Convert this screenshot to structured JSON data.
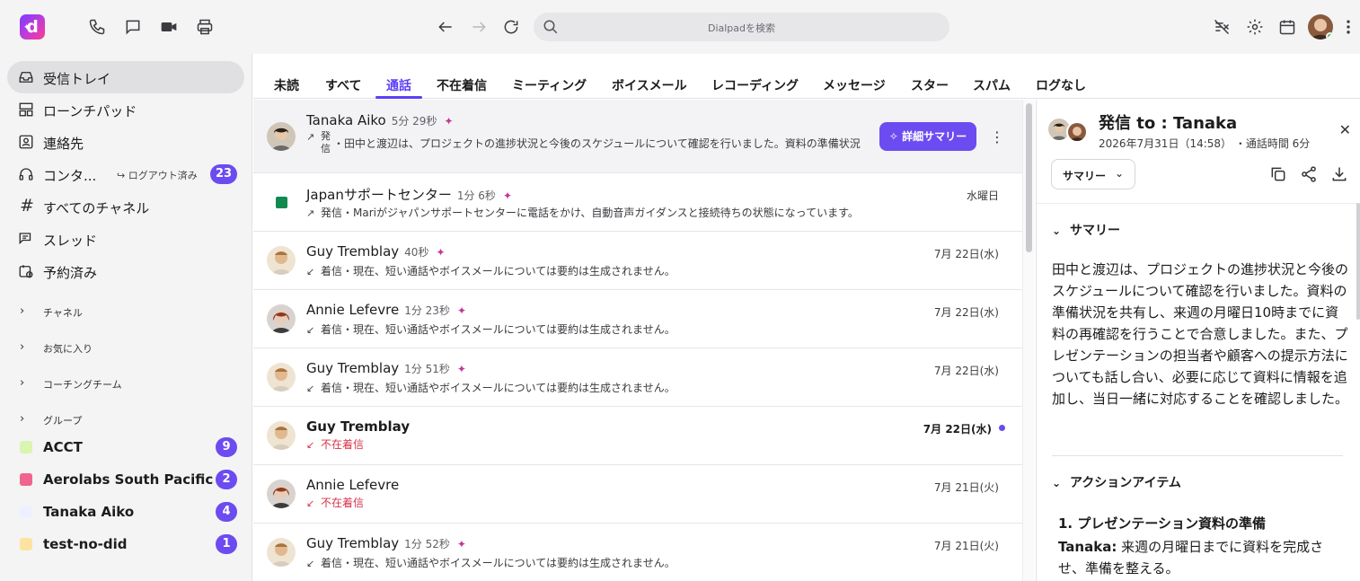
{
  "topbar": {
    "logo_letter": "d",
    "search_placeholder": "Dialpadを検索",
    "icons": [
      "phone-icon",
      "chat-icon",
      "video-icon",
      "print-icon",
      "back-arrow-icon",
      "forward-arrow-icon",
      "refresh-icon",
      "no-music-icon",
      "gear-icon",
      "calendar-icon",
      "more-vertical-icon"
    ]
  },
  "sidebar": {
    "nav": [
      {
        "label": "受信トレイ",
        "icon": "inbox-icon"
      },
      {
        "label": "ローンチパッド",
        "icon": "launchpad-icon"
      },
      {
        "label": "連絡先",
        "icon": "contacts-icon"
      },
      {
        "label": "コンタ...",
        "icon": "headset-icon",
        "sub": "ログアウト済み",
        "badge": "23"
      },
      {
        "label": "すべてのチャネル",
        "icon": "hash-icon"
      },
      {
        "label": "スレッド",
        "icon": "threads-icon"
      },
      {
        "label": "予約済み",
        "icon": "scheduled-icon"
      }
    ],
    "groups": [
      {
        "label": "チャネル"
      },
      {
        "label": "お気に入り"
      },
      {
        "label": "コーチングチーム"
      },
      {
        "label": "グループ"
      }
    ],
    "channels": [
      {
        "label": "ACCT",
        "badge": "9",
        "color": "#d9f5b0"
      },
      {
        "label": "Aerolabs South Pacific",
        "badge": "2",
        "color": "#f0648e"
      },
      {
        "label": "Tanaka Aiko",
        "badge": "4",
        "color": "#eef0ff"
      },
      {
        "label": "test-no-did",
        "badge": "1",
        "color": "#fde3a1"
      }
    ]
  },
  "tabs": [
    "未読",
    "すべて",
    "通話",
    "不在着信",
    "ミーティング",
    "ボイスメール",
    "レコーディング",
    "メッセージ",
    "スター",
    "スパム",
    "ログなし"
  ],
  "active_tab": "通話",
  "list": [
    {
      "name": "Tanaka Aiko",
      "duration": "5分 29秒",
      "kind": "発信",
      "kind_short": "発 信",
      "text": "・田中と渡辺は、プロジェクトの進捗状況と今後のスケジュールについて確認を行いました。資料の準備状況",
      "button": "詳細サマリー",
      "date": ""
    },
    {
      "name": "Japanサポートセンター",
      "duration": "1分 6秒",
      "kind": "発信",
      "text": "・Mariがジャパンサポートセンターに電話をかけ、自動音声ガイダンスと接続待ちの状態になっています。",
      "date": "水曜日"
    },
    {
      "name": "Guy Tremblay",
      "duration": "40秒",
      "kind": "着信",
      "text": "・現在、短い通話やボイスメールについては要約は生成されません。",
      "date": "7月 22日(水)"
    },
    {
      "name": "Annie Lefevre",
      "duration": "1分 23秒",
      "kind": "着信",
      "text": "・現在、短い通話やボイスメールについては要約は生成されません。",
      "date": "7月 22日(水)"
    },
    {
      "name": "Guy Tremblay",
      "duration": "1分 51秒",
      "kind": "着信",
      "text": "・現在、短い通話やボイスメールについては要約は生成されません。",
      "date": "7月 22日(水)"
    },
    {
      "name": "Guy Tremblay",
      "duration": "",
      "kind": "不在着信",
      "text": "",
      "date": "7月 22日(水)"
    },
    {
      "name": "Annie Lefevre",
      "duration": "",
      "kind": "不在着信",
      "text": "",
      "date": "7月 21日(火)"
    },
    {
      "name": "Guy Tremblay",
      "duration": "1分 52秒",
      "kind": "着信",
      "text": "・現在、短い通話やボイスメールについては要約は生成されません。",
      "date": "7月 21日(火)"
    }
  ],
  "detail": {
    "title": "発信 to : Tanaka",
    "date": "2026年7月31日（14:58）",
    "duration": "・通話時間 6分",
    "select_label": "サマリー",
    "summary_heading": "サマリー",
    "summary_text": "田中と渡辺は、プロジェクトの進捗状況と今後のスケジュールについて確認を行いました。資料の準備状況を共有し、来週の月曜日10時までに資料の再確認を行うことで合意しました。また、プレゼンテーションの担当者や顧客への提示方法についても話し合い、必要に応じて資料に情報を追加し、当日一緒に対応することを確認しました。",
    "actions_heading": "アクションアイテム",
    "action_1_title": "1.  プレゼンテーション資料の準備",
    "action_1_owner": "Tanaka:",
    "action_1_text": " 来週の月曜日までに資料を完成させ、準備を整える。"
  }
}
